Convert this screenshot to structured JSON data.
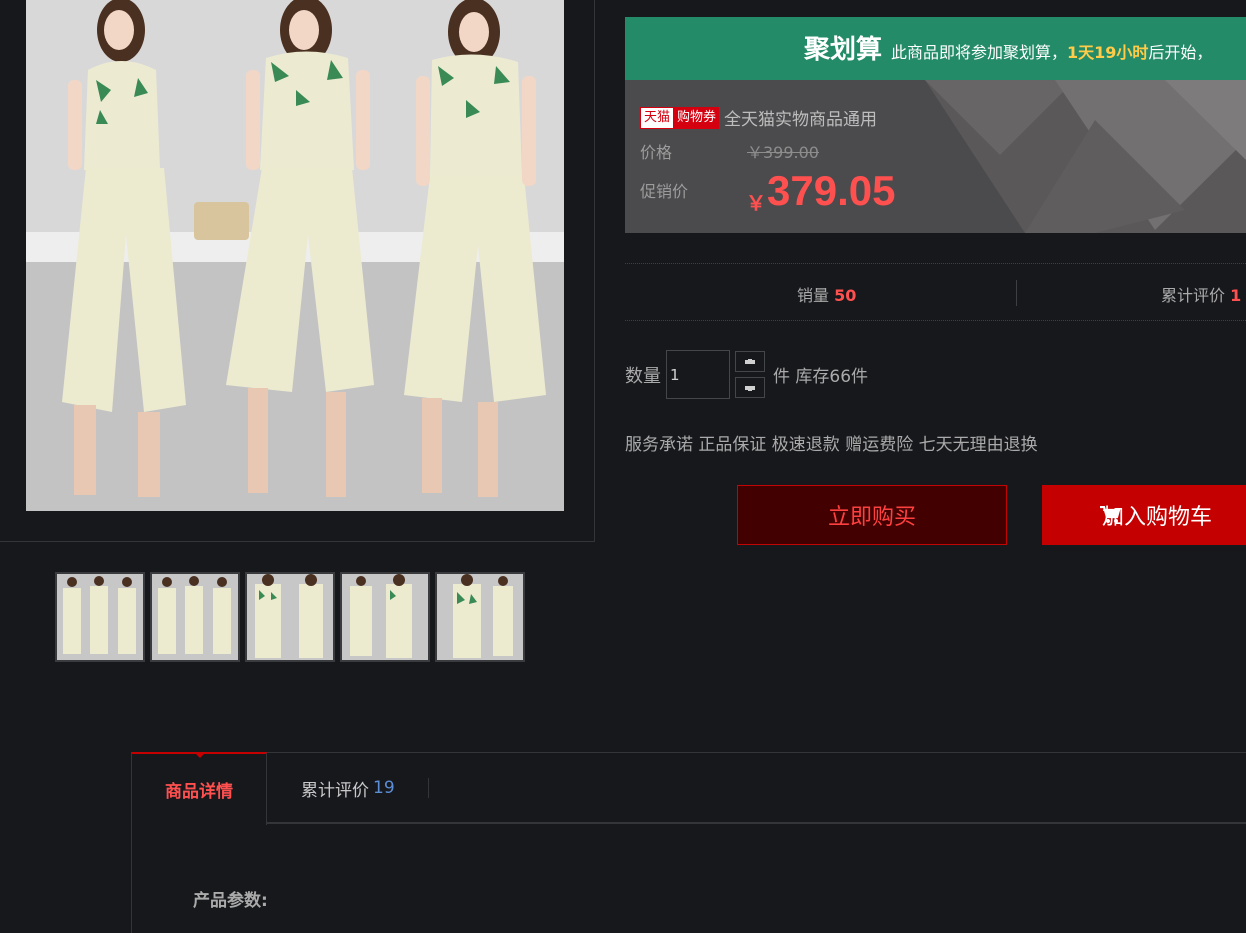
{
  "gallery": {
    "thumbnails": [
      {
        "name": "thumb-1"
      },
      {
        "name": "thumb-2"
      },
      {
        "name": "thumb-3"
      },
      {
        "name": "thumb-4"
      },
      {
        "name": "thumb-5"
      }
    ]
  },
  "juhuasuan": {
    "title": "聚划算",
    "note_prefix": "此商品即将参加聚划算，",
    "countdown": "1天19小时",
    "note_suffix": "后开始，"
  },
  "price": {
    "tag_tmall": "天猫",
    "tag_coupon": "购物券",
    "coupon_text": "全天猫实物商品通用",
    "price_label": "价格",
    "original_price": "￥399.00",
    "promo_label": "促销价",
    "promo_currency": "￥",
    "promo_price": "379.05"
  },
  "stats": {
    "sales_label": "销量",
    "sales_value": "50",
    "reviews_label": "累计评价",
    "reviews_value": "1"
  },
  "purchase": {
    "qty_label": "数量",
    "qty_value": "1",
    "unit": "件",
    "stock": "库存66件",
    "service": "服务承诺 正品保证 极速退款 赠运费险 七天无理由退换",
    "buy_now": "立即购买",
    "add_cart": "加入购物车"
  },
  "tabs": {
    "detail": "商品详情",
    "reviews": "累计评价",
    "reviews_count": "19"
  },
  "detail": {
    "params_title": "产品参数:"
  },
  "colors": {
    "accent_red": "#ff5050",
    "button_red": "#c40000",
    "ju_green": "#248b68",
    "countdown_gold": "#ffcc4a",
    "link_blue": "#5c8ed6",
    "background": "#17181c"
  }
}
